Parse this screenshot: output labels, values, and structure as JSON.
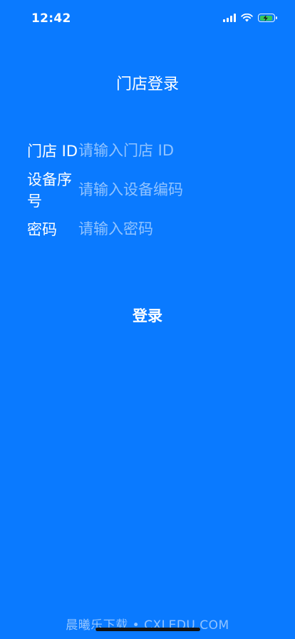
{
  "status_bar": {
    "time": "12:42",
    "signal_icon": "cellular-signal-icon",
    "wifi_icon": "wifi-icon",
    "battery_icon": "battery-charging-icon",
    "battery_fill_color": "#34C759"
  },
  "header": {
    "title": "门店登录"
  },
  "form": {
    "store_id": {
      "label": "门店 ID",
      "placeholder": "请输入门店 ID",
      "value": ""
    },
    "device_no": {
      "label": "设备序号",
      "placeholder": "请输入设备编码",
      "value": ""
    },
    "password": {
      "label": "密码",
      "placeholder": "请输入密码",
      "value": ""
    }
  },
  "login_button": {
    "label": "登录"
  },
  "watermark": {
    "text": "晨曦乐下载 • CXLEDU.COM"
  },
  "colors": {
    "background": "#0A7AFF",
    "text": "#FFFFFF"
  }
}
